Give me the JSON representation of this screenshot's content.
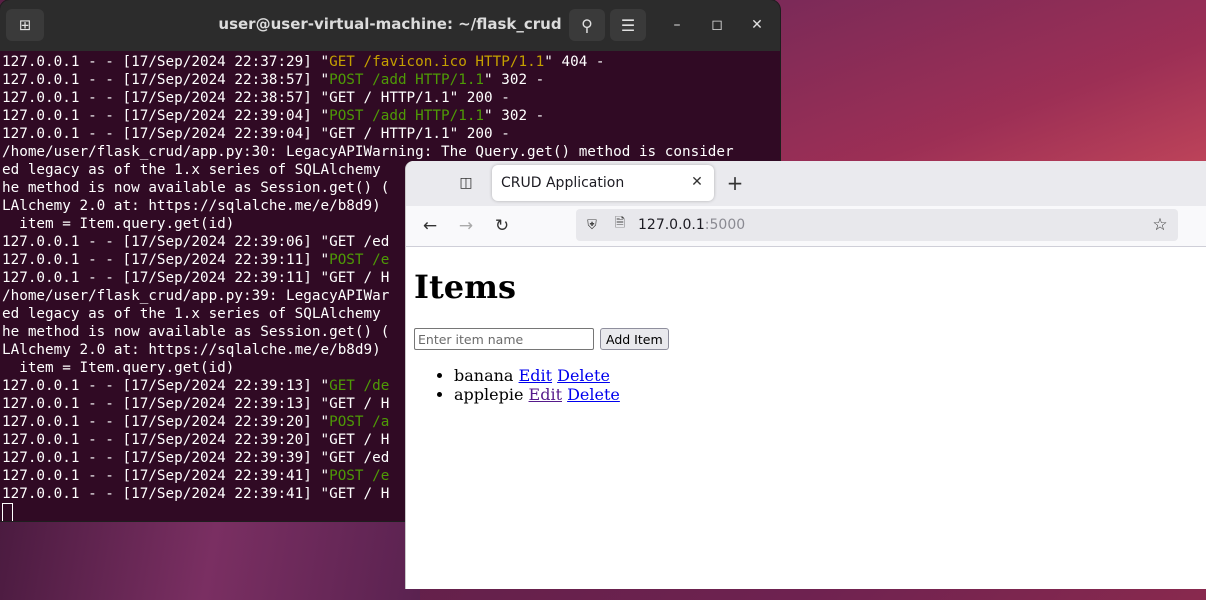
{
  "terminal": {
    "title": "user@user-virtual-machine: ~/flask_crud",
    "icons": {
      "new_tab": "new-tab-icon",
      "search": "search-icon",
      "menu": "hamburger-menu-icon",
      "minimize": "minimize-icon",
      "maximize": "maximize-icon",
      "close": "close-icon"
    },
    "lines": [
      [
        {
          "t": "127.0.0.1 - - [17/Sep/2024 22:37:29] \""
        },
        {
          "t": "GET /favicon.ico HTTP/1.1",
          "c": "yellow"
        },
        {
          "t": "\" 404 -"
        }
      ],
      [
        {
          "t": "127.0.0.1 - - [17/Sep/2024 22:38:57] \""
        },
        {
          "t": "POST /add HTTP/1.1",
          "c": "green"
        },
        {
          "t": "\" 302 -"
        }
      ],
      [
        {
          "t": "127.0.0.1 - - [17/Sep/2024 22:38:57] \"GET / HTTP/1.1\" 200 -"
        }
      ],
      [
        {
          "t": "127.0.0.1 - - [17/Sep/2024 22:39:04] \""
        },
        {
          "t": "POST /add HTTP/1.1",
          "c": "green"
        },
        {
          "t": "\" 302 -"
        }
      ],
      [
        {
          "t": "127.0.0.1 - - [17/Sep/2024 22:39:04] \"GET / HTTP/1.1\" 200 -"
        }
      ],
      [
        {
          "t": "/home/user/flask_crud/app.py:30: LegacyAPIWarning: The Query.get() method is consider"
        }
      ],
      [
        {
          "t": "ed legacy as of the 1.x series of SQLAlchemy"
        }
      ],
      [
        {
          "t": "he method is now available as Session.get() ("
        }
      ],
      [
        {
          "t": "LAlchemy 2.0 at: https://sqlalche.me/e/b8d9)"
        }
      ],
      [
        {
          "t": "  item = Item.query.get(id)"
        }
      ],
      [
        {
          "t": "127.0.0.1 - - [17/Sep/2024 22:39:06] \"GET /ed"
        }
      ],
      [
        {
          "t": "127.0.0.1 - - [17/Sep/2024 22:39:11] \""
        },
        {
          "t": "POST /e",
          "c": "green"
        }
      ],
      [
        {
          "t": "127.0.0.1 - - [17/Sep/2024 22:39:11] \"GET / H"
        }
      ],
      [
        {
          "t": "/home/user/flask_crud/app.py:39: LegacyAPIWar"
        }
      ],
      [
        {
          "t": "ed legacy as of the 1.x series of SQLAlchemy"
        }
      ],
      [
        {
          "t": "he method is now available as Session.get() ("
        }
      ],
      [
        {
          "t": "LAlchemy 2.0 at: https://sqlalche.me/e/b8d9)"
        }
      ],
      [
        {
          "t": "  item = Item.query.get(id)"
        }
      ],
      [
        {
          "t": "127.0.0.1 - - [17/Sep/2024 22:39:13] \""
        },
        {
          "t": "GET /de",
          "c": "green"
        }
      ],
      [
        {
          "t": "127.0.0.1 - - [17/Sep/2024 22:39:13] \"GET / H"
        }
      ],
      [
        {
          "t": "127.0.0.1 - - [17/Sep/2024 22:39:20] \""
        },
        {
          "t": "POST /a",
          "c": "green"
        }
      ],
      [
        {
          "t": "127.0.0.1 - - [17/Sep/2024 22:39:20] \"GET / H"
        }
      ],
      [
        {
          "t": "127.0.0.1 - - [17/Sep/2024 22:39:39] \"GET /ed"
        }
      ],
      [
        {
          "t": "127.0.0.1 - - [17/Sep/2024 22:39:41] \""
        },
        {
          "t": "POST /e",
          "c": "green"
        }
      ],
      [
        {
          "t": "127.0.0.1 - - [17/Sep/2024 22:39:41] \"GET / H"
        }
      ]
    ]
  },
  "browser": {
    "tab_title": "CRUD Application",
    "url_host": "127.0.0.1",
    "url_port": ":5000",
    "icons": {
      "tab_list": "tab-list-icon",
      "tab_close": "close-icon",
      "new_tab": "plus-icon",
      "back": "back-arrow-icon",
      "forward": "forward-arrow-icon",
      "reload": "reload-icon",
      "shield": "shield-icon",
      "page": "page-icon",
      "bookmark": "star-icon"
    }
  },
  "page": {
    "heading": "Items",
    "input_placeholder": "Enter item name",
    "add_button": "Add Item",
    "items": [
      {
        "name": "banana",
        "edit": "Edit",
        "delete": "Delete",
        "edit_visited": false
      },
      {
        "name": "applepie",
        "edit": "Edit",
        "delete": "Delete",
        "edit_visited": true
      }
    ]
  }
}
